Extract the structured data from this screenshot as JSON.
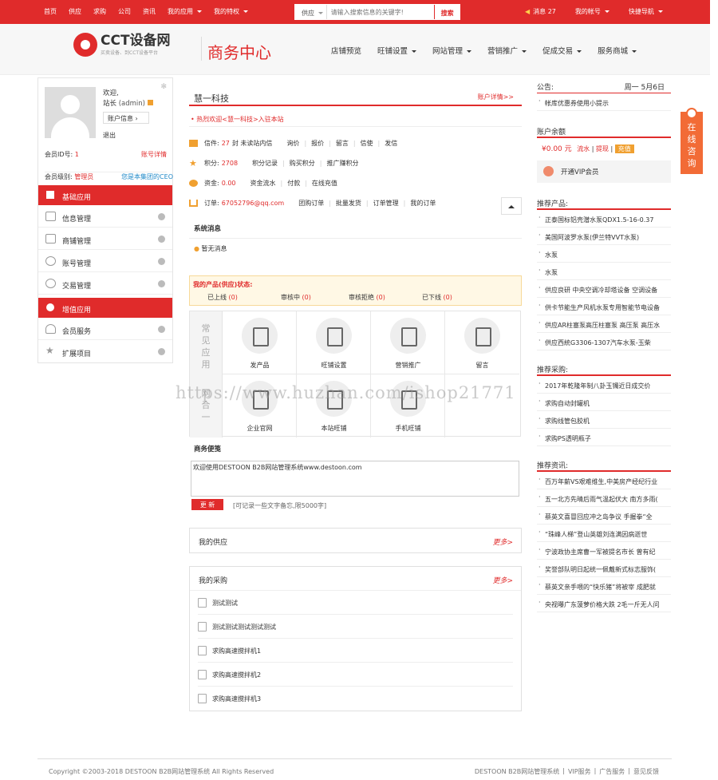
{
  "topbar": {
    "nav": [
      "首页",
      "供应",
      "求购",
      "公司",
      "资讯",
      "我的应用",
      "我的特权"
    ],
    "search_select": "供应",
    "search_placeholder": "请输入搜索信息的关键字!",
    "search_button": "搜索",
    "messages": "消息 27",
    "my_account": "我的帐号",
    "quick_nav": "快捷导航"
  },
  "header": {
    "logo_title": "CCT设备网",
    "logo_sub": "买卖设备、到CCT设备平台",
    "page_title": "商务中心",
    "nav": [
      "店铺预览",
      "旺铺设置",
      "网站管理",
      "营销推广",
      "促成交易",
      "服务商城"
    ]
  },
  "sidebar": {
    "welcome": "欢迎,",
    "user": "站长",
    "user_id": "(admin)",
    "account_info": "账户信息",
    "logout": "退出",
    "member_id_label": "会员ID号:",
    "member_id": "1",
    "account_detail": "账号详情",
    "level_label": "会员级别:",
    "level": "管理员",
    "ceo": "您是本集团的CEO",
    "section_basic": "基础应用",
    "items_basic": [
      "信息管理",
      "商铺管理",
      "账号管理",
      "交易管理"
    ],
    "section_value": "增值应用",
    "items_value": [
      "会员服务",
      "扩展项目"
    ]
  },
  "main": {
    "company": "慧一科技",
    "account_detail": "账户详情>>",
    "welcome_marquee": "热烈欢迎<慧一科技>入驻本站",
    "rows": [
      {
        "label": "信件:",
        "value": "27",
        "extra": "封 未读站内信",
        "links": [
          "询价",
          "报价",
          "留言",
          "信使",
          "发信"
        ]
      },
      {
        "label": "积分:",
        "value": "2708",
        "extra": "",
        "links": [
          "积分记录",
          "购买积分",
          "推广赚积分"
        ]
      },
      {
        "label": "资金:",
        "value": "0.00",
        "extra": "",
        "links": [
          "资金流水",
          "付款",
          "在线充值"
        ]
      },
      {
        "label": "订单:",
        "value": "67052796@qq.com",
        "extra": "",
        "links": [
          "团购订单",
          "批量发货",
          "订单管理",
          "我的订单"
        ]
      }
    ],
    "system_msg_title": "系统消息",
    "system_msg": "暂无消息",
    "product_status_title": "我的产品(供应)状态:",
    "product_status": [
      {
        "label": "已上线",
        "count": "(0)"
      },
      {
        "label": "审核中",
        "count": "(0)"
      },
      {
        "label": "审核拒绝",
        "count": "(0)"
      },
      {
        "label": "已下线",
        "count": "(0)"
      }
    ],
    "grid_side_1": "常见应用",
    "grid_side_2": "网合一",
    "grid_items": [
      "发产品",
      "旺铺设置",
      "营销推广",
      "留言",
      "企业官网",
      "本站旺铺",
      "手机旺铺"
    ],
    "memo_title": "商务便笺",
    "memo_text": "欢迎使用DESTOON B2B网站管理系统www.destoon.com",
    "memo_button": "更 新",
    "memo_note": "[可记录一些文字备忘,限5000字]",
    "supply_title": "我的供应",
    "more": "更多>",
    "purchase_title": "我的采购",
    "purchase_list": [
      "测试测试",
      "测试测试测试测试测试",
      "求购高速搅拌机1",
      "求购高速搅拌机2",
      "求购高速搅拌机3"
    ]
  },
  "right": {
    "notice": "公告:",
    "date": "周一  5月6日",
    "notice_item": "帐库优惠券使用小提示",
    "balance_title": "账户余额",
    "balance": "¥0.00 元",
    "flow": "流水",
    "withdraw": "提现",
    "recharge": "充值",
    "vip": "开通VIP会员",
    "rec_products_title": "推荐产品:",
    "rec_products": [
      "正泰国标铝壳潜水泵QDX1.5-16-0.37",
      "美国阿波罗水泵(伊兰特VVT水泵)",
      "水泵",
      "水泵",
      "供应良研 中央空调冷却塔设备 空调设备",
      "供卡节能生产风机水泵专用智能节电设备",
      "供应AR柱塞泵高压柱塞泵 高压泵 高压水",
      "供应西統G3306-1307汽车水泵-玉柴"
    ],
    "rec_purchase_title": "推荐采购:",
    "rec_purchase": [
      "2017年乾隆年制八卦玉镯近日成交价",
      "求购自动封罐机",
      "求购线管包胶机",
      "求购PS透明瓶子"
    ],
    "rec_news_title": "推荐资讯:",
    "rec_news": [
      "百万年薪VS艰难维生,中美房产经纪行业",
      "五一北方先晴后雨气温起伏大 南方多雨(",
      "蔡英文喜冒回应冲之岛争议 手握拳“全",
      "“珠峰人梯”登山英雄刘连满因病逝世",
      "宁波政协主席曹一军被提名市长 曾有纪",
      "奖誉部队明日起统一佩戴新式标志服饰(",
      "蔡英文亲手喂的“快乐猪”将被宰 成肥就",
      "央视曝广东菠萝价格大跌 2毛一斤无人问"
    ]
  },
  "float": "在线咨询",
  "watermark": "https://www.huzhan.com/ishop21771",
  "footer": {
    "copyright": "Copyright ©2003-2018 DESTOON B2B网站管理系统 All Rights Reserved",
    "links": [
      "DESTOON B2B网站管理系统",
      "VIP服务",
      "广告服务",
      "意见反馈"
    ]
  },
  "colors": {
    "brand": "#e02b2b",
    "float": "#f26b36"
  }
}
